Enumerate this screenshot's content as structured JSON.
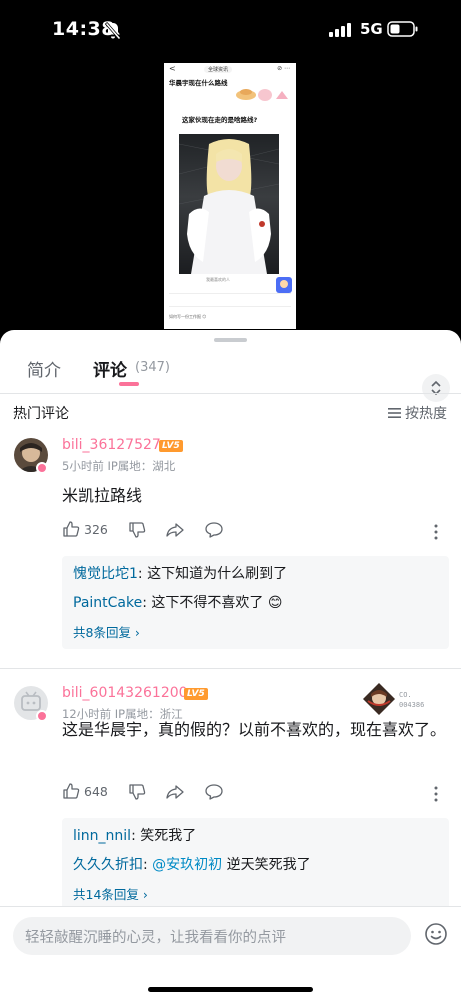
{
  "status_bar": {
    "time": "14:38",
    "network": "5G"
  },
  "video": {
    "frame_back": "<",
    "frame_account": "全球资讯",
    "frame_title": "华晨宇现在什么路线",
    "frame_question": "这家伙现在走的是啥路线?",
    "frame_caption": "我最喜欢的人",
    "frame_footer": "如何写一份工作报 😊"
  },
  "tabs": {
    "intro": "简介",
    "comments": "评论",
    "comment_count": "(347)"
  },
  "section": {
    "title": "热门评论",
    "sort_label": "按热度"
  },
  "colors": {
    "accent": "#fb7299",
    "reply_name": "#00699d",
    "level_badge": "#ff9a2e"
  },
  "comments": [
    {
      "username": "bili_36127527",
      "level": "LV5",
      "meta": "5小时前  IP属地：湖北",
      "text": "米凯拉路线",
      "likes": "326",
      "replies": [
        {
          "name": "愧觉比坨1",
          "text": ": 这下知道为什么刷到了"
        },
        {
          "name": "PaintCake",
          "text": ": 这下不得不喜欢了 😊"
        }
      ],
      "more_replies": "共8条回复 ›"
    },
    {
      "username": "bili_60143261200",
      "level": "LV5",
      "meta": "12小时前  IP属地：浙江",
      "text": "这是华晨宇，真的假的？以前不喜欢的，现在喜欢了。",
      "likes": "648",
      "tile_text_1": "CO.",
      "tile_text_2": "004386",
      "replies": [
        {
          "name": "linn_nnil",
          "text": ": 笑死我了"
        },
        {
          "name": "久久久折扣",
          "mention": "@安玖初初",
          "text": " 逆天笑死我了"
        }
      ],
      "more_replies": "共14条回复 ›"
    }
  ],
  "input": {
    "placeholder": "轻轻敲醒沉睡的心灵，让我看看你的点评"
  },
  "icons": [
    "bell-off-icon",
    "signal-icon",
    "battery-icon",
    "chevron-updown-icon",
    "sort-icon",
    "thumb-up-icon",
    "thumb-down-icon",
    "share-icon",
    "comment-icon",
    "more-icon",
    "emoji-icon"
  ]
}
